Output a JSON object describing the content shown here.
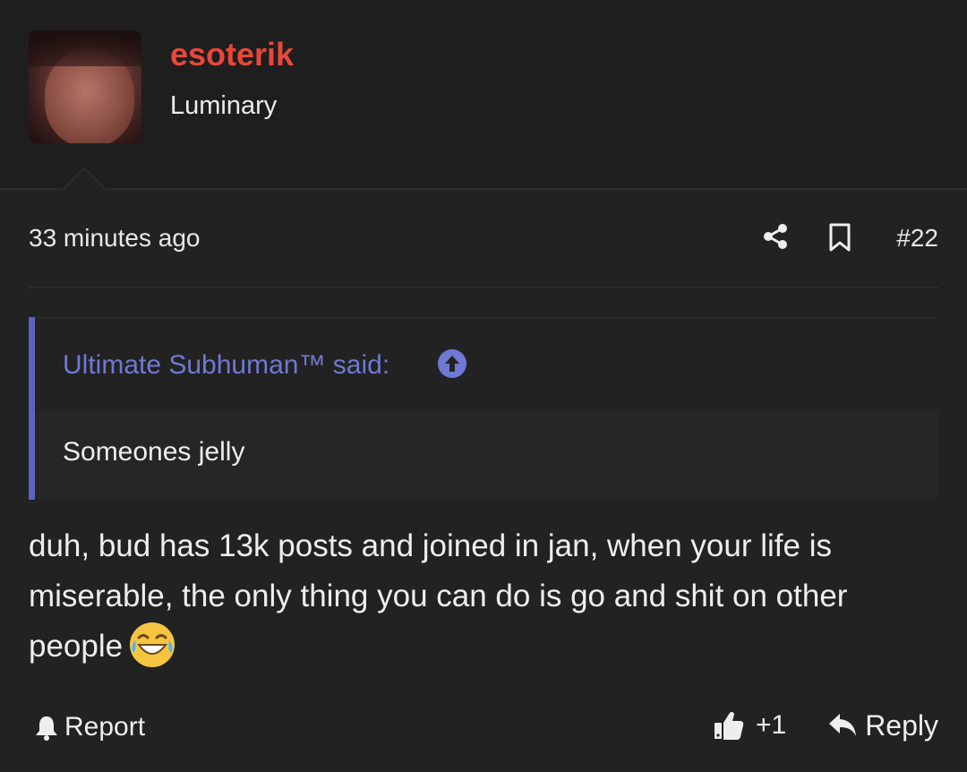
{
  "author": {
    "username": "esoterik",
    "title": "Luminary",
    "username_color": "#e8473a"
  },
  "meta": {
    "timestamp": "33 minutes ago",
    "post_number": "#22"
  },
  "quote": {
    "author_label": "Ultimate Subhuman™ said:",
    "body": "Someones jelly",
    "accent_color": "#5a64c0"
  },
  "post": {
    "body": "duh, bud has 13k posts and joined in jan, when your life is miserable, the only thing you can do is go and shit on other people",
    "emoji": "rofl-emoji"
  },
  "actions": {
    "report_label": "Report",
    "like_count": "+1",
    "reply_label": "Reply"
  },
  "icons": [
    "share-icon",
    "bookmark-icon",
    "arrow-up-circle-icon",
    "bell-icon",
    "thumbs-up-icon",
    "reply-arrow-icon"
  ]
}
